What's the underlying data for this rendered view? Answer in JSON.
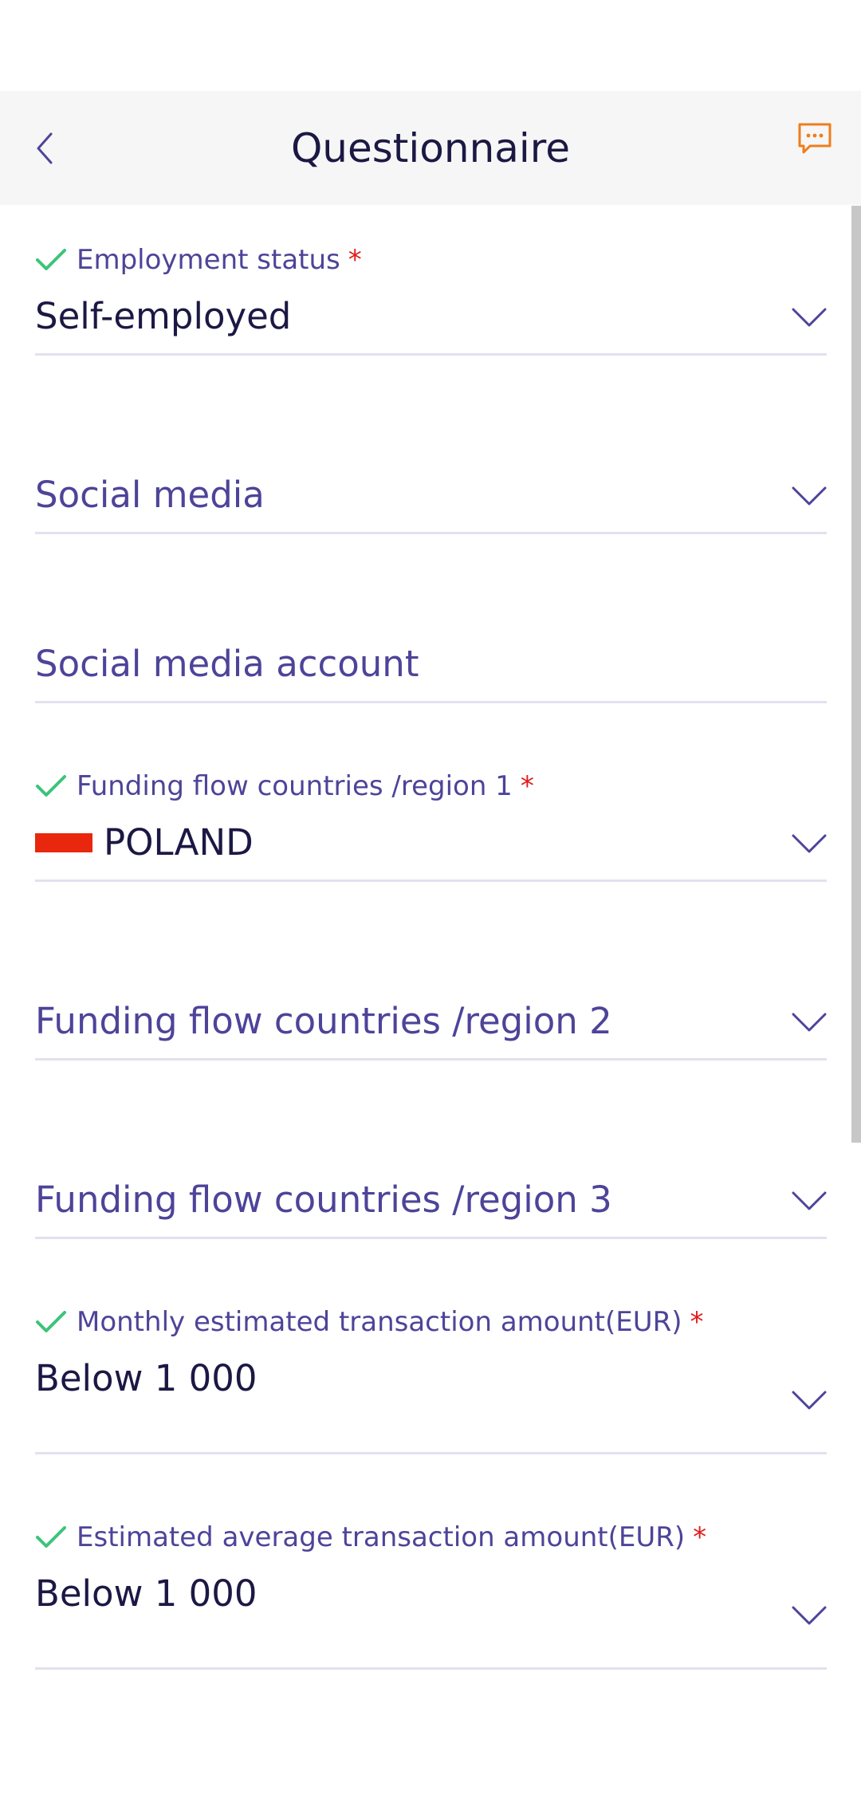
{
  "header": {
    "title": "Questionnaire",
    "back_icon": "chevron-left-icon",
    "chat_icon": "chat-bubble-icon"
  },
  "colors": {
    "accent": "#4d4499",
    "text": "#1c1844",
    "check": "#3cc47a",
    "required": "#e01b1b",
    "chat": "#ef7d1a",
    "flag_poland": "#e8270e"
  },
  "form": {
    "employment_status": {
      "label": "Employment status",
      "required": "*",
      "value": "Self-employed"
    },
    "social_media": {
      "placeholder": "Social media"
    },
    "social_media_account": {
      "placeholder": "Social media account"
    },
    "funding_region_1": {
      "label": "Funding flow countries /region 1",
      "required": "*",
      "value": "POLAND"
    },
    "funding_region_2": {
      "placeholder": "Funding flow countries /region 2"
    },
    "funding_region_3": {
      "placeholder": "Funding flow countries /region 3"
    },
    "monthly_amount": {
      "label": "Monthly estimated transaction amount(EUR)",
      "required": "*",
      "value": "Below 1 000"
    },
    "average_amount": {
      "label": "Estimated average transaction amount(EUR)",
      "required": "*",
      "value": "Below 1 000"
    }
  }
}
